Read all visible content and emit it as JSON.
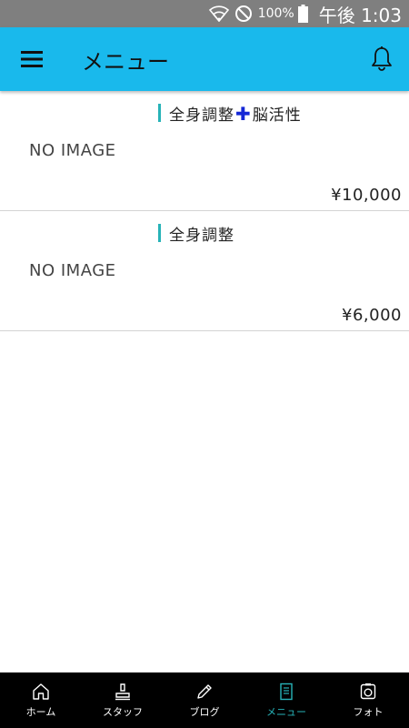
{
  "status_bar": {
    "battery_percent": "100%",
    "time": "午後 1:03"
  },
  "app_bar": {
    "title": "メニュー"
  },
  "menu_items": [
    {
      "title_part1": "全身調整",
      "plus": "✚",
      "title_part2": "脳活性",
      "image_placeholder": "NO IMAGE",
      "price": "¥10,000"
    },
    {
      "title": "全身調整",
      "image_placeholder": "NO IMAGE",
      "price": "¥6,000"
    }
  ],
  "bottom_nav": {
    "items": [
      {
        "label": "ホーム",
        "icon": "home-icon",
        "active": false
      },
      {
        "label": "スタッフ",
        "icon": "staff-icon",
        "active": false
      },
      {
        "label": "ブログ",
        "icon": "pencil-icon",
        "active": false
      },
      {
        "label": "メニュー",
        "icon": "menu-document-icon",
        "active": true
      },
      {
        "label": "フォト",
        "icon": "camera-icon",
        "active": false
      }
    ]
  },
  "colors": {
    "app_bar": "#19b9ec",
    "accent": "#27b3b8",
    "plus": "#1528d6",
    "status_bar": "#7f7f7f"
  }
}
